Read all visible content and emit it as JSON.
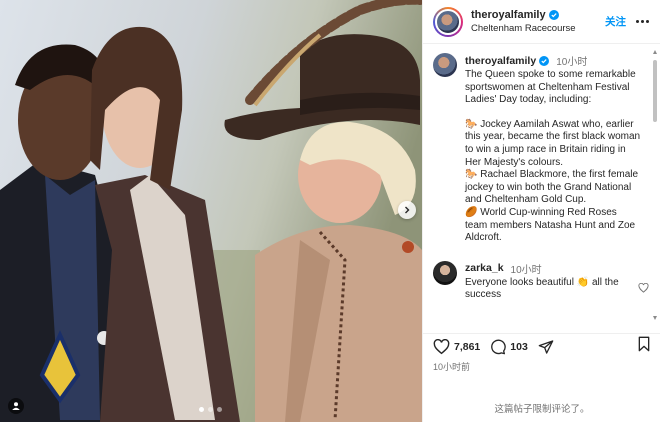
{
  "post": {
    "account": "theroyalfamily",
    "location": "Cheltenham Racecourse",
    "follow_label": "关注",
    "caption_time": "10小时",
    "caption": [
      "The Queen spoke to some remarkable sportswomen at Cheltenham Festival Ladies' Day today, including:",
      "",
      "🐎 Jockey Aamilah Aswat who, earlier this year, became the first black woman to win a jump race in Britain riding in Her Majesty's colours.",
      "🐎 Rachael Blackmore, the first female jockey to win both the Grand National and Cheltenham Gold Cup.",
      "🏉 World Cup-winning Red Roses team members Natasha Hunt and Zoe Aldcroft."
    ],
    "likes": "7,861",
    "comments_count": "103",
    "posted_time": "10小时前",
    "comments_limited": "这篇帖子限制评论了。"
  },
  "comment": {
    "user": "zarka_k",
    "time": "10小时",
    "text": "Everyone looks beautiful 👏 all the success"
  },
  "photo": {
    "carousel_total": 3,
    "carousel_active": 1
  },
  "colors": {
    "link_blue": "#0095f6",
    "verified_blue": "#0095f6",
    "text": "#262626",
    "muted": "#737373"
  },
  "icons": [
    "verified-badge-icon",
    "more-options-icon",
    "heart-icon",
    "comment-icon",
    "share-icon",
    "bookmark-icon",
    "next-arrow-icon",
    "tagged-user-icon"
  ]
}
